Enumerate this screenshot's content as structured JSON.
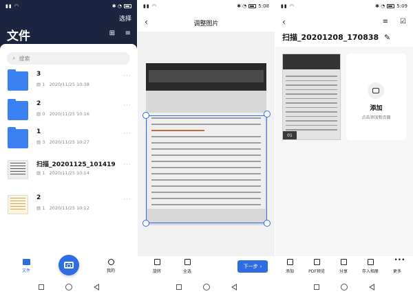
{
  "screen1": {
    "status_right": "",
    "select_label": "选择",
    "title": "文件",
    "search_placeholder": "搜索",
    "files": [
      {
        "name": "3",
        "count": "1",
        "date": "2020/11/25 10:38"
      },
      {
        "name": "2",
        "count": "0",
        "date": "2020/11/25 10:16"
      },
      {
        "name": "1",
        "count": "3",
        "date": "2020/11/25 10:27"
      },
      {
        "name": "扫描_20201125_101419",
        "count": "1",
        "date": "2020/11/25 10:14"
      },
      {
        "name": "2",
        "count": "1",
        "date": "2020/11/25 10:12"
      }
    ],
    "tab_files": "文件",
    "tab_mine": "我的"
  },
  "screen2": {
    "status_time": "5:08",
    "title": "调整图片",
    "tool_rotate": "旋转",
    "tool_select_all": "全选",
    "next_label": "下一步"
  },
  "screen3": {
    "status_time": "5:09",
    "title": "扫描_20201208_170838",
    "page_number": "01",
    "add_label": "添加",
    "add_hint": "点击添加新页面",
    "tools": [
      "添加",
      "PDF预览",
      "分享",
      "存入相册",
      "更多"
    ]
  },
  "colors": {
    "primary": "#2f6de1",
    "header_dark": "#1c2540"
  },
  "icons": [
    "search-icon",
    "folder-icon",
    "camera-icon",
    "back-icon",
    "edit-icon",
    "sort-icon",
    "check-icon",
    "rotate-icon",
    "select-all-icon",
    "more-icon"
  ]
}
